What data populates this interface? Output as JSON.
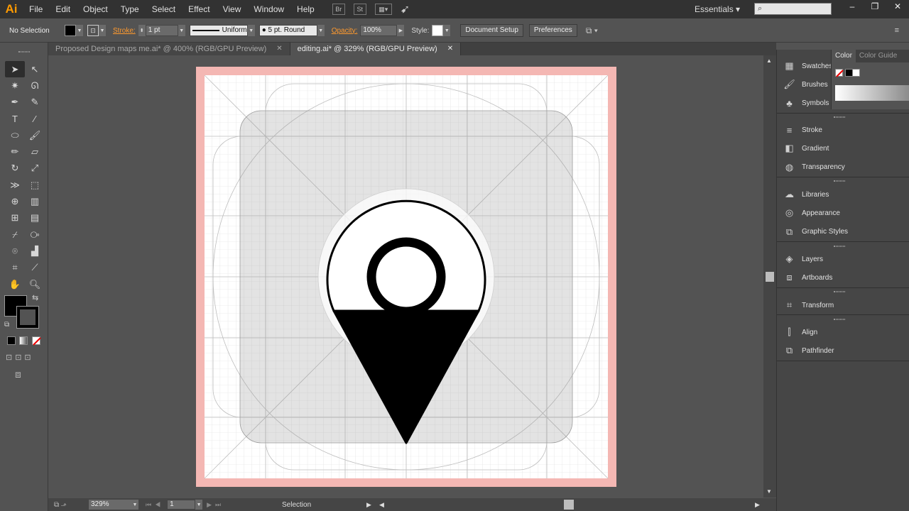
{
  "app": {
    "logo": "Ai",
    "workspace": "Essentials",
    "search_placeholder": ""
  },
  "menu": [
    "File",
    "Edit",
    "Object",
    "Type",
    "Select",
    "Effect",
    "View",
    "Window",
    "Help"
  ],
  "menu_icons": {
    "bridge": "Br",
    "stock": "St"
  },
  "window_controls": {
    "minimize": "–",
    "restore": "❐",
    "close": "✕"
  },
  "control": {
    "selection_label": "No Selection",
    "stroke_label": "Stroke:",
    "stroke_weight": "1 pt",
    "profile": "Uniform",
    "brush": "5 pt. Round",
    "opacity_label": "Opacity:",
    "opacity": "100%",
    "style_label": "Style:",
    "document_setup": "Document Setup",
    "preferences": "Preferences"
  },
  "tabs": [
    {
      "label": "Proposed Design maps me.ai* @ 400% (RGB/GPU Preview)",
      "close": "✕"
    },
    {
      "label": "editing.ai* @ 329% (RGB/GPU Preview)",
      "close": "✕"
    }
  ],
  "status": {
    "zoom": "329%",
    "artboard": "1",
    "tool": "Selection"
  },
  "color_panel": {
    "tabs": [
      "Color",
      "Color Guide"
    ]
  },
  "panels": [
    {
      "items": [
        {
          "label": "Swatches",
          "icon": "swatches-icon"
        },
        {
          "label": "Brushes",
          "icon": "brushes-icon"
        },
        {
          "label": "Symbols",
          "icon": "symbols-icon"
        }
      ]
    },
    {
      "items": [
        {
          "label": "Stroke",
          "icon": "stroke-icon"
        },
        {
          "label": "Gradient",
          "icon": "gradient-icon"
        },
        {
          "label": "Transparency",
          "icon": "transparency-icon"
        }
      ]
    },
    {
      "items": [
        {
          "label": "Libraries",
          "icon": "libraries-icon"
        },
        {
          "label": "Appearance",
          "icon": "appearance-icon"
        },
        {
          "label": "Graphic Styles",
          "icon": "graphic-styles-icon"
        }
      ]
    },
    {
      "items": [
        {
          "label": "Layers",
          "icon": "layers-icon"
        },
        {
          "label": "Artboards",
          "icon": "artboards-icon"
        }
      ]
    },
    {
      "items": [
        {
          "label": "Transform",
          "icon": "transform-icon"
        }
      ]
    },
    {
      "items": [
        {
          "label": "Align",
          "icon": "align-icon"
        },
        {
          "label": "Pathfinder",
          "icon": "pathfinder-icon"
        }
      ]
    }
  ],
  "colors": {
    "accent": "#ff9a00",
    "bleed": "#f4b7b3",
    "artboard": "#ffffff",
    "pin": "#000000"
  }
}
